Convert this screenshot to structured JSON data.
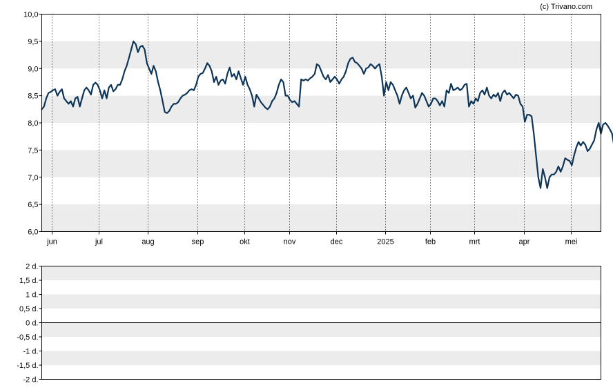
{
  "copyright": "(c) Trivano.com",
  "colors": {
    "line": "#0d3558",
    "band": "#ececec",
    "axis": "#000000",
    "grid_dotted": "#000000"
  },
  "chart_data": [
    {
      "type": "line",
      "title": "",
      "xlabel": "",
      "ylabel": "",
      "ylim": [
        6.0,
        10.0
      ],
      "y_ticks": [
        "10,0",
        "9,5",
        "9,0",
        "8,5",
        "8,0",
        "7,5",
        "7,0",
        "6,5",
        "6,0"
      ],
      "y_tick_values": [
        10.0,
        9.5,
        9.0,
        8.5,
        8.0,
        7.5,
        7.0,
        6.5,
        6.0
      ],
      "x_tick_labels": [
        "jun",
        "jul",
        "aug",
        "sep",
        "okt",
        "nov",
        "dec",
        "2025",
        "feb",
        "mrt",
        "apr",
        "mei"
      ],
      "x_tick_positions": [
        4.5,
        25.5,
        47.5,
        69.5,
        90.5,
        110.5,
        131.5,
        153.5,
        173.5,
        193.5,
        215.5,
        236.5
      ],
      "x_range": [
        0,
        250
      ],
      "grid": "dotted vertical at month starts, alternating horizontal bands",
      "series": [
        {
          "values": [
            8.25,
            8.3,
            8.45,
            8.55,
            8.57,
            8.6,
            8.62,
            8.5,
            8.57,
            8.62,
            8.45,
            8.4,
            8.35,
            8.4,
            8.3,
            8.45,
            8.48,
            8.3,
            8.45,
            8.6,
            8.65,
            8.6,
            8.52,
            8.7,
            8.74,
            8.7,
            8.6,
            8.45,
            8.6,
            8.45,
            8.65,
            8.7,
            8.58,
            8.62,
            8.7,
            8.7,
            8.8,
            8.95,
            9.05,
            9.2,
            9.35,
            9.5,
            9.45,
            9.3,
            9.4,
            9.42,
            9.35,
            9.1,
            9.0,
            8.9,
            9.05,
            8.95,
            8.75,
            8.6,
            8.4,
            8.2,
            8.18,
            8.22,
            8.3,
            8.35,
            8.35,
            8.38,
            8.45,
            8.5,
            8.52,
            8.55,
            8.6,
            8.62,
            8.6,
            8.7,
            8.85,
            8.9,
            8.92,
            9.0,
            9.1,
            9.05,
            8.95,
            8.75,
            8.85,
            8.7,
            8.78,
            8.8,
            8.72,
            8.9,
            9.02,
            8.85,
            8.9,
            8.8,
            8.95,
            8.82,
            8.7,
            8.85,
            8.7,
            8.62,
            8.5,
            8.3,
            8.52,
            8.45,
            8.38,
            8.33,
            8.28,
            8.25,
            8.3,
            8.4,
            8.45,
            8.55,
            8.7,
            8.8,
            8.75,
            8.5,
            8.5,
            8.42,
            8.38,
            8.4,
            8.35,
            8.3,
            8.8,
            8.78,
            8.8,
            8.78,
            8.82,
            8.85,
            8.9,
            9.08,
            9.05,
            8.95,
            8.85,
            8.8,
            8.88,
            8.75,
            8.8,
            8.85,
            8.8,
            8.72,
            8.8,
            8.85,
            8.95,
            9.1,
            9.18,
            9.2,
            9.12,
            9.1,
            9.05,
            9.0,
            8.9,
            9.0,
            9.02,
            9.08,
            9.05,
            9.0,
            9.05,
            9.08,
            8.85,
            8.5,
            8.75,
            8.6,
            8.75,
            8.7,
            8.6,
            8.5,
            8.35,
            8.5,
            8.6,
            8.65,
            8.55,
            8.45,
            8.5,
            8.28,
            8.35,
            8.45,
            8.55,
            8.5,
            8.4,
            8.3,
            8.35,
            8.45,
            8.45,
            8.4,
            8.32,
            8.4,
            8.3,
            8.6,
            8.55,
            8.72,
            8.6,
            8.62,
            8.65,
            8.6,
            8.63,
            8.7,
            8.72,
            8.3,
            8.4,
            8.35,
            8.45,
            8.4,
            8.55,
            8.6,
            8.52,
            8.65,
            8.5,
            8.45,
            8.52,
            8.48,
            8.55,
            8.4,
            8.55,
            8.6,
            8.52,
            8.55,
            8.5,
            8.45,
            8.52,
            8.5,
            8.35,
            8.3,
            8.02,
            8.15,
            8.15,
            8.12,
            7.8,
            7.4,
            7.0,
            6.8,
            7.15,
            7.0,
            6.8,
            7.0,
            7.05,
            7.05,
            7.1,
            7.2,
            7.1,
            7.2,
            7.35,
            7.32,
            7.3,
            7.22,
            7.4,
            7.55,
            7.65,
            7.58,
            7.65,
            7.6,
            7.48,
            7.52,
            7.6,
            7.68,
            7.88,
            8.0,
            7.8,
            7.97,
            8.0,
            7.95,
            7.88,
            7.8,
            7.55,
            7.58,
            7.6
          ]
        }
      ]
    },
    {
      "type": "line",
      "title": "",
      "ylim": [
        -2,
        2
      ],
      "y_ticks": [
        "2 d.",
        "1,5 d.",
        "1 d.",
        "0,5 d.",
        "0 d.",
        "-0,5 d.",
        "-1 d.",
        "-1,5 d.",
        "-2 d."
      ],
      "y_tick_values": [
        2,
        1.5,
        1,
        0.5,
        0,
        -0.5,
        -1,
        -1.5,
        -2
      ],
      "grid": "alternating horizontal bands, solid zero line",
      "series": []
    }
  ]
}
